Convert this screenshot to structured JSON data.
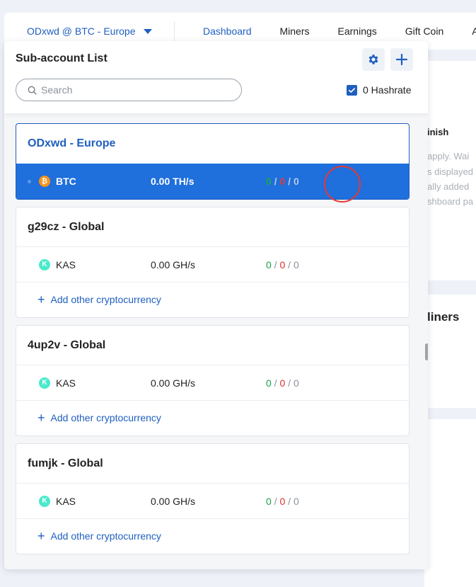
{
  "nav": {
    "account_label": "ODxwd @ BTC - Europe",
    "links": [
      "Dashboard",
      "Miners",
      "Earnings",
      "Gift Coin",
      "A"
    ]
  },
  "background": {
    "finish_text": "inish",
    "lines": [
      "apply. Wai",
      "s displayed",
      "ally added",
      "shboard pa"
    ],
    "miners_title": "liners"
  },
  "panel": {
    "title": "Sub-account List",
    "search_placeholder": "Search",
    "hashrate_label": "0 Hashrate",
    "add_label": "Add other cryptocurrency"
  },
  "subaccounts": [
    {
      "name": "ODxwd - Europe",
      "coin": "BTC",
      "hashrate": "0.00 TH/s",
      "counts": [
        "0",
        "0",
        "0"
      ]
    },
    {
      "name": "g29cz - Global",
      "coin": "KAS",
      "hashrate": "0.00 GH/s",
      "counts": [
        "0",
        "0",
        "0"
      ]
    },
    {
      "name": "4up2v - Global",
      "coin": "KAS",
      "hashrate": "0.00 GH/s",
      "counts": [
        "0",
        "0",
        "0"
      ]
    },
    {
      "name": "fumjk - Global",
      "coin": "KAS",
      "hashrate": "0.00 GH/s",
      "counts": [
        "0",
        "0",
        "0"
      ]
    }
  ],
  "colors": {
    "accent": "#1f5fbf",
    "active_row": "#1f6fdc",
    "online": "#1aa34a",
    "offline": "#e02d2d",
    "inactive": "#8a929c"
  }
}
